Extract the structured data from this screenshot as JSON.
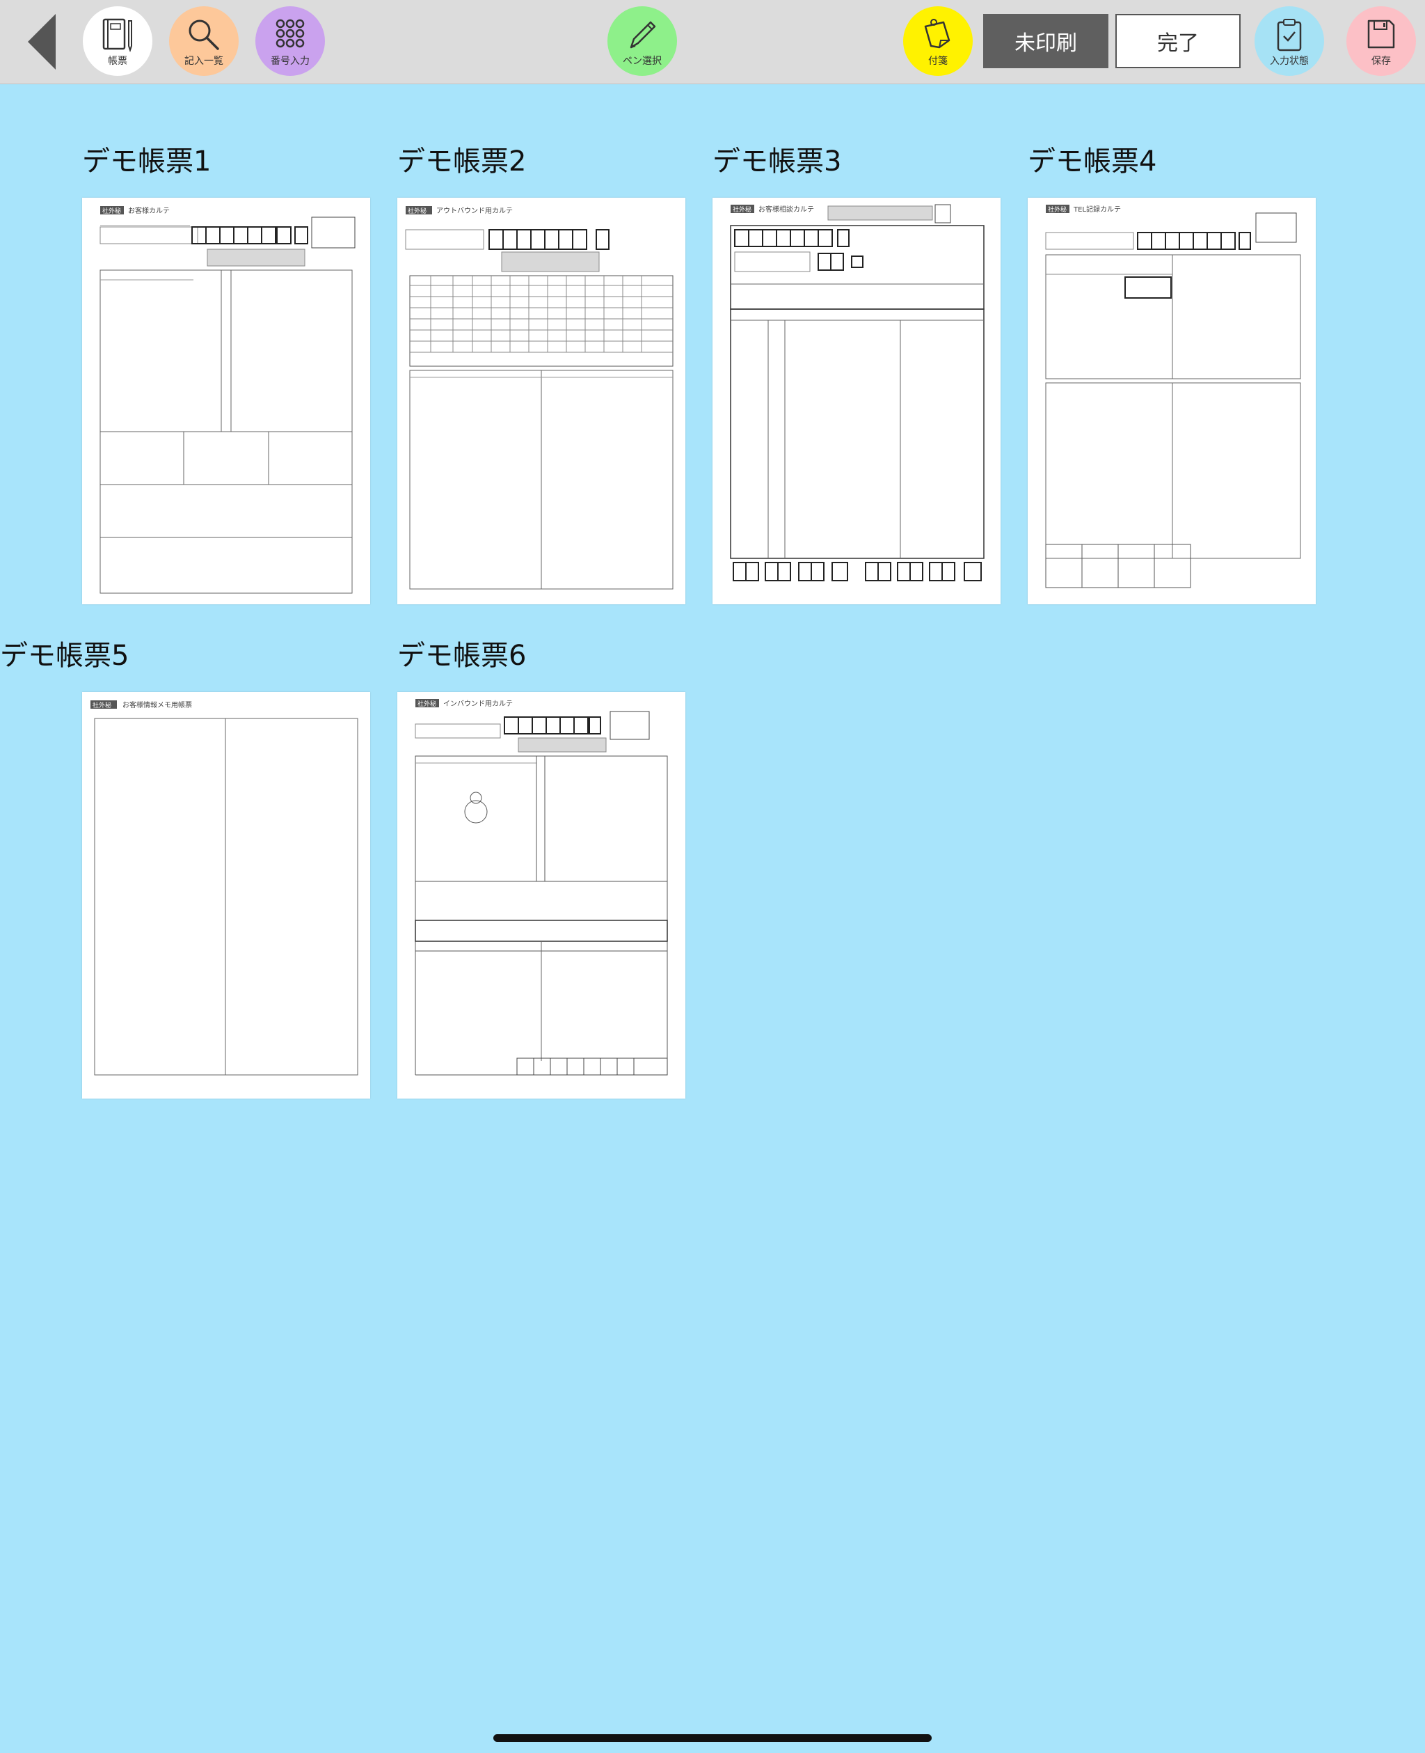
{
  "toolbar": {
    "back_icon": "back-triangle-icon",
    "buttons": [
      {
        "label": "帳票",
        "icon": "form-book-icon",
        "color": "#ffffff"
      },
      {
        "label": "記入一覧",
        "icon": "search-icon",
        "color": "#fdc89a"
      },
      {
        "label": "番号入力",
        "icon": "keypad-icon",
        "color": "#caa2ee"
      },
      {
        "label": "ペン選択",
        "icon": "pen-icon",
        "color": "#8ef08a"
      },
      {
        "label": "付箋",
        "icon": "sticky-note-icon",
        "color": "#fff200"
      },
      {
        "label": "入力状態",
        "icon": "clipboard-check-icon",
        "color": "#a6e2f5"
      },
      {
        "label": "保存",
        "icon": "save-icon",
        "color": "#fcc0c6"
      }
    ],
    "unprinted_label": "未印刷",
    "done_label": "完了"
  },
  "documents": [
    {
      "title": "デモ帳票1",
      "form_title": "お客様カルテ"
    },
    {
      "title": "デモ帳票2",
      "form_title": "アウトバウンド用カルテ"
    },
    {
      "title": "デモ帳票3",
      "form_title": "お客様相談カルテ"
    },
    {
      "title": "デモ帳票4",
      "form_title": "TEL記録カルテ"
    },
    {
      "title": "デモ帳票5",
      "form_title": "お客様情報メモ用帳票"
    },
    {
      "title": "デモ帳票6",
      "form_title": "インバウンド用カルテ"
    }
  ],
  "form_badge": "社外秘",
  "colors": {
    "background": "#a8e4fb",
    "toolbar": "#dcdcdc",
    "unprinted": "#5f5f5f"
  }
}
